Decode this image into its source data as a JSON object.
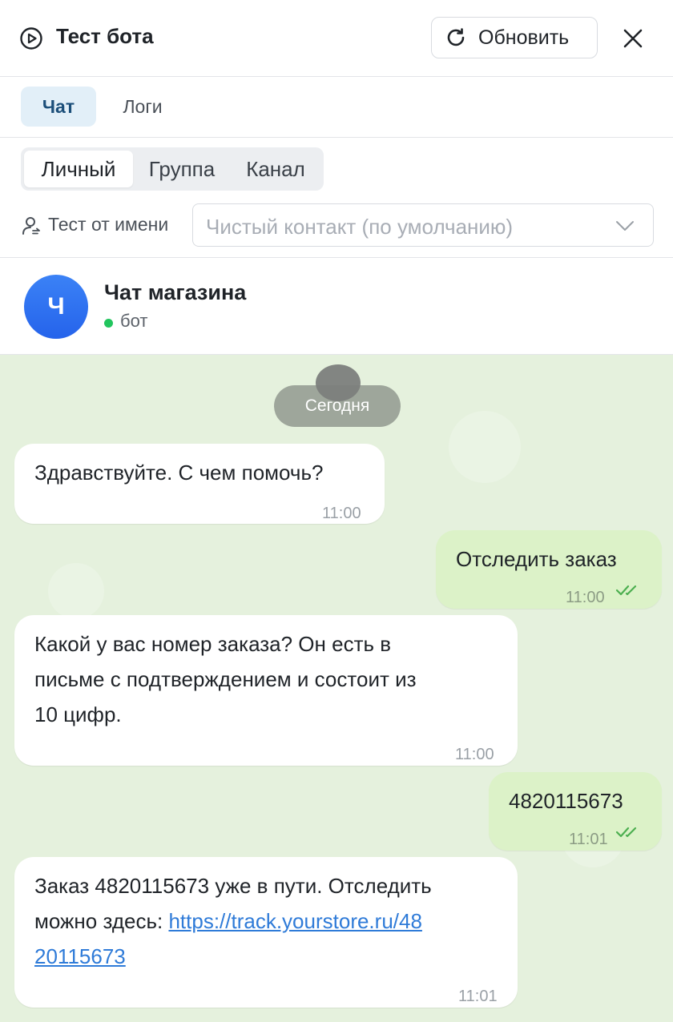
{
  "header": {
    "title": "Тест бота",
    "refresh_label": "Обновить"
  },
  "tabs": [
    {
      "label": "Чат",
      "active": true
    },
    {
      "label": "Логи",
      "active": false
    }
  ],
  "chat_type": {
    "options": [
      "Личный",
      "Группа",
      "Канал"
    ],
    "selected": "Личный"
  },
  "test_as": {
    "label": "Тест от имени",
    "placeholder": "Чистый контакт (по умолчанию)"
  },
  "chat": {
    "name": "Чат магазина",
    "avatar_letter": "Ч",
    "status": "бот",
    "status_color": "#22c55e",
    "date_divider": "Сегодня"
  },
  "messages": [
    {
      "direction": "in",
      "text": "Здравствуйте. С чем помочь?",
      "time": "11:00"
    },
    {
      "direction": "out",
      "text": "Отследить заказ",
      "time": "11:00",
      "read": true
    },
    {
      "direction": "in",
      "lines": [
        "Какой у вас номер заказа? Он есть в",
        "письме с подтверждением и состоит из",
        "10 цифр."
      ],
      "time": "11:00"
    },
    {
      "direction": "out",
      "text": "4820115673",
      "time": "11:01",
      "read": true
    },
    {
      "direction": "in",
      "line1": "Заказ 4820115673 уже в пути. Отследить",
      "line2_prefix": "можно здесь: ",
      "link_part1": "https://track.yourstore.ru/48",
      "link_part2": "20115673",
      "time": "11:01"
    }
  ],
  "colors": {
    "accent": "#2563eb",
    "tab_active_bg": "#e2eff8",
    "chat_bg": "#e5f1dd",
    "outgoing_bubble": "#dcf2c8",
    "read_ticks": "#4caf50",
    "link": "#2f7bd8"
  }
}
